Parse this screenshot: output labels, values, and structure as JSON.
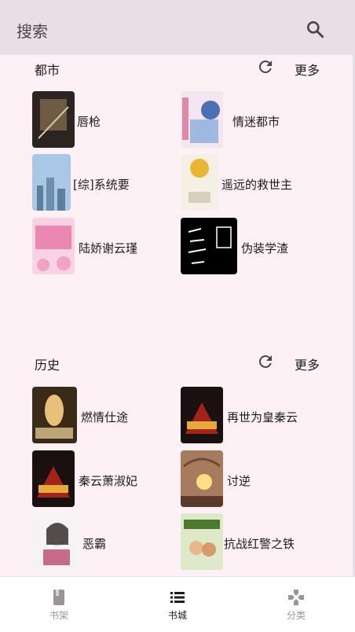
{
  "appbar": {
    "title": "搜索",
    "search_icon": "search-icon"
  },
  "sections": [
    {
      "title": "都市",
      "refresh_icon": "refresh-icon",
      "more_label": "更多",
      "books": [
        {
          "title": "唇枪",
          "cover_colors": [
            "#2b2420",
            "#8a7356"
          ]
        },
        {
          "title": "情迷都市",
          "cover_colors": [
            "#f3e6f0",
            "#4a6fb5"
          ]
        },
        {
          "title": "[综]系统要",
          "cover_colors": [
            "#a8c8e6",
            "#5d7e9e"
          ]
        },
        {
          "title": "遥远的救世主",
          "cover_colors": [
            "#f4f0e4",
            "#e8b630"
          ]
        },
        {
          "title": "陆娇谢云瑾",
          "cover_colors": [
            "#f8d3e3",
            "#e04a8a"
          ]
        },
        {
          "title": "伪装学渣",
          "cover_colors": [
            "#000000",
            "#ffffff"
          ]
        }
      ]
    },
    {
      "title": "历史",
      "refresh_icon": "refresh-icon",
      "more_label": "更多",
      "books": [
        {
          "title": "燃情仕途",
          "cover_colors": [
            "#3a2a18",
            "#e8c07a"
          ]
        },
        {
          "title": "再世为皇秦云",
          "cover_colors": [
            "#1a1010",
            "#c4281e"
          ]
        },
        {
          "title": "秦云萧淑妃",
          "cover_colors": [
            "#1a1010",
            "#c4281e"
          ]
        },
        {
          "title": "讨逆",
          "cover_colors": [
            "#a87a5e",
            "#ffe080"
          ]
        },
        {
          "title": "恶霸",
          "cover_colors": [
            "#f4f4f4",
            "#c86a8a"
          ]
        },
        {
          "title": "抗战红警之铁",
          "cover_colors": [
            "#dfe8c8",
            "#4a7a2e"
          ]
        }
      ]
    }
  ],
  "bottom_nav": [
    {
      "label": "书架",
      "icon": "book-icon",
      "active": false
    },
    {
      "label": "书城",
      "icon": "list-icon",
      "active": true
    },
    {
      "label": "分类",
      "icon": "gamepad-icon",
      "active": false
    }
  ],
  "colors": {
    "background": "#fdf1f5",
    "appbar": "#e9dee6",
    "text": "#1c1b1f"
  }
}
